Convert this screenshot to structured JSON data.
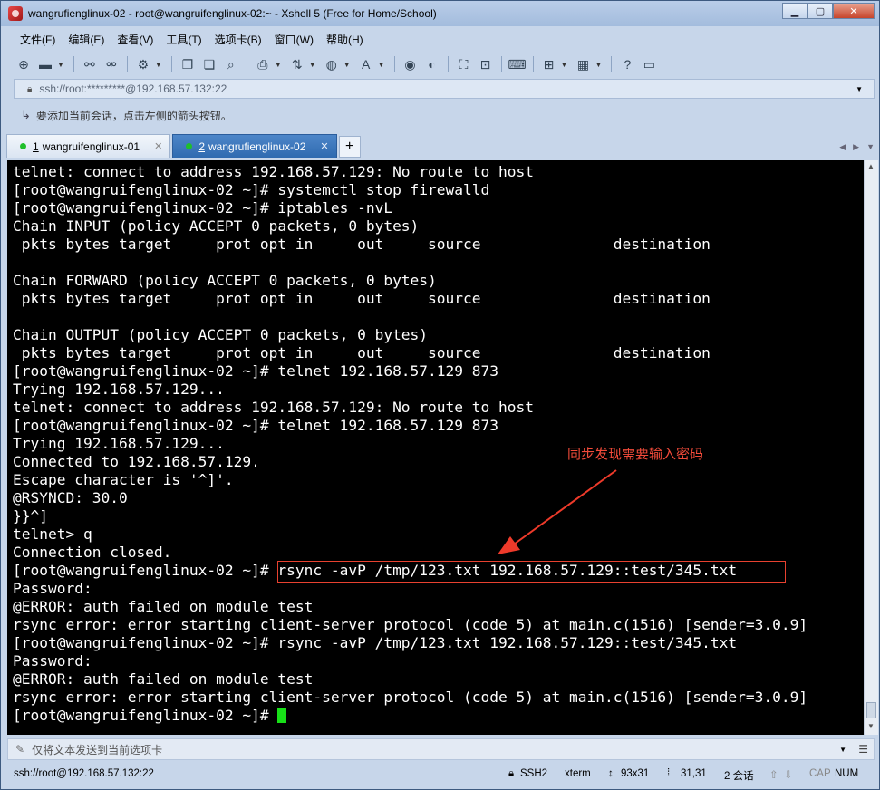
{
  "window": {
    "title": "wangrufienglinux-02 - root@wangruifenglinux-02:~ - Xshell 5 (Free for Home/School)",
    "controls": {
      "minimize": "▁",
      "maximize": "▢",
      "close": "✕"
    }
  },
  "menu": [
    "文件(F)",
    "编辑(E)",
    "查看(V)",
    "工具(T)",
    "选项卡(B)",
    "窗口(W)",
    "帮助(H)"
  ],
  "address": {
    "text": "ssh://root:*********@192.168.57.132:22"
  },
  "hint": {
    "text": "要添加当前会话，点击左侧的箭头按钮。"
  },
  "tabs": [
    {
      "num": "1",
      "label": "wangruifenglinux-01",
      "active": false
    },
    {
      "num": "2",
      "label": "wangrufienglinux-02",
      "active": true
    }
  ],
  "terminal": {
    "lines": [
      "telnet: connect to address 192.168.57.129: No route to host",
      "[root@wangruifenglinux-02 ~]# systemctl stop firewalld",
      "[root@wangruifenglinux-02 ~]# iptables -nvL",
      "Chain INPUT (policy ACCEPT 0 packets, 0 bytes)",
      " pkts bytes target     prot opt in     out     source               destination",
      "",
      "Chain FORWARD (policy ACCEPT 0 packets, 0 bytes)",
      " pkts bytes target     prot opt in     out     source               destination",
      "",
      "Chain OUTPUT (policy ACCEPT 0 packets, 0 bytes)",
      " pkts bytes target     prot opt in     out     source               destination",
      "[root@wangruifenglinux-02 ~]# telnet 192.168.57.129 873",
      "Trying 192.168.57.129...",
      "telnet: connect to address 192.168.57.129: No route to host",
      "[root@wangruifenglinux-02 ~]# telnet 192.168.57.129 873",
      "Trying 192.168.57.129...",
      "Connected to 192.168.57.129.",
      "Escape character is '^]'.",
      "@RSYNCD: 30.0",
      "}}^]",
      "telnet> q",
      "Connection closed.",
      "[root@wangruifenglinux-02 ~]# rsync -avP /tmp/123.txt 192.168.57.129::test/345.txt",
      "Password:",
      "@ERROR: auth failed on module test",
      "rsync error: error starting client-server protocol (code 5) at main.c(1516) [sender=3.0.9]",
      "[root@wangruifenglinux-02 ~]# rsync -avP /tmp/123.txt 192.168.57.129::test/345.txt",
      "Password:",
      "@ERROR: auth failed on module test",
      "rsync error: error starting client-server protocol (code 5) at main.c(1516) [sender=3.0.9]"
    ],
    "prompt": "[root@wangruifenglinux-02 ~]# ",
    "annotation": "同步发现需要输入密码",
    "annotation_color": "#f24b3a"
  },
  "compose": {
    "text": "仅将文本发送到当前选项卡"
  },
  "status": {
    "connection": "ssh://root@192.168.57.132:22",
    "protocol": "SSH2",
    "term": "xterm",
    "size": "93x31",
    "position": "31,31",
    "sessions": "2 会话",
    "cap": "CAP",
    "num": "NUM"
  }
}
